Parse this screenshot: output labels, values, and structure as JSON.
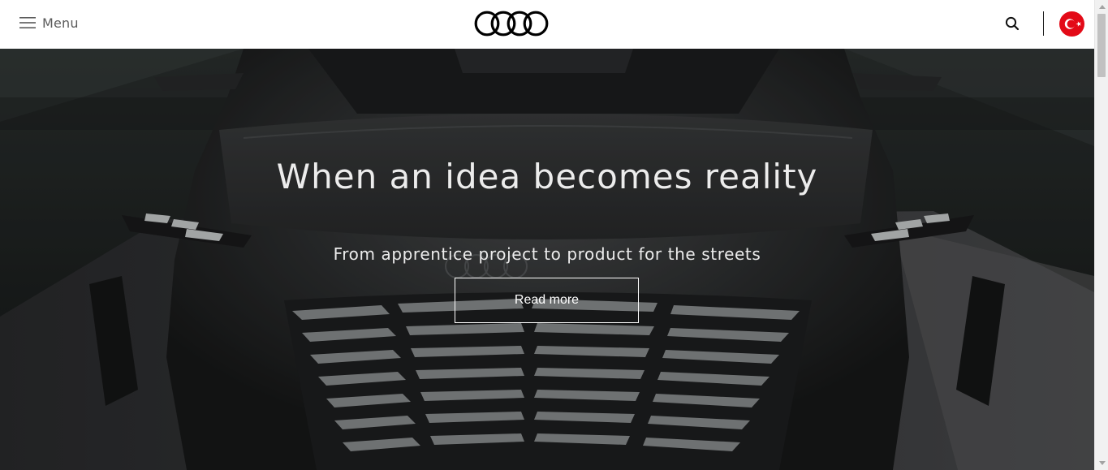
{
  "header": {
    "menu_label": "Menu",
    "menu_icon": "hamburger-icon",
    "logo_icon": "audi-rings-logo",
    "search_icon": "search-icon",
    "flag_icon": "turkey-flag-icon"
  },
  "hero": {
    "title": "When an idea becomes reality",
    "subtitle": "From apprentice project to product for the streets",
    "cta_label": "Read more"
  },
  "colors": {
    "header_bg": "#ffffff",
    "hero_text": "#ececec",
    "flag_red": "#e30a17"
  }
}
